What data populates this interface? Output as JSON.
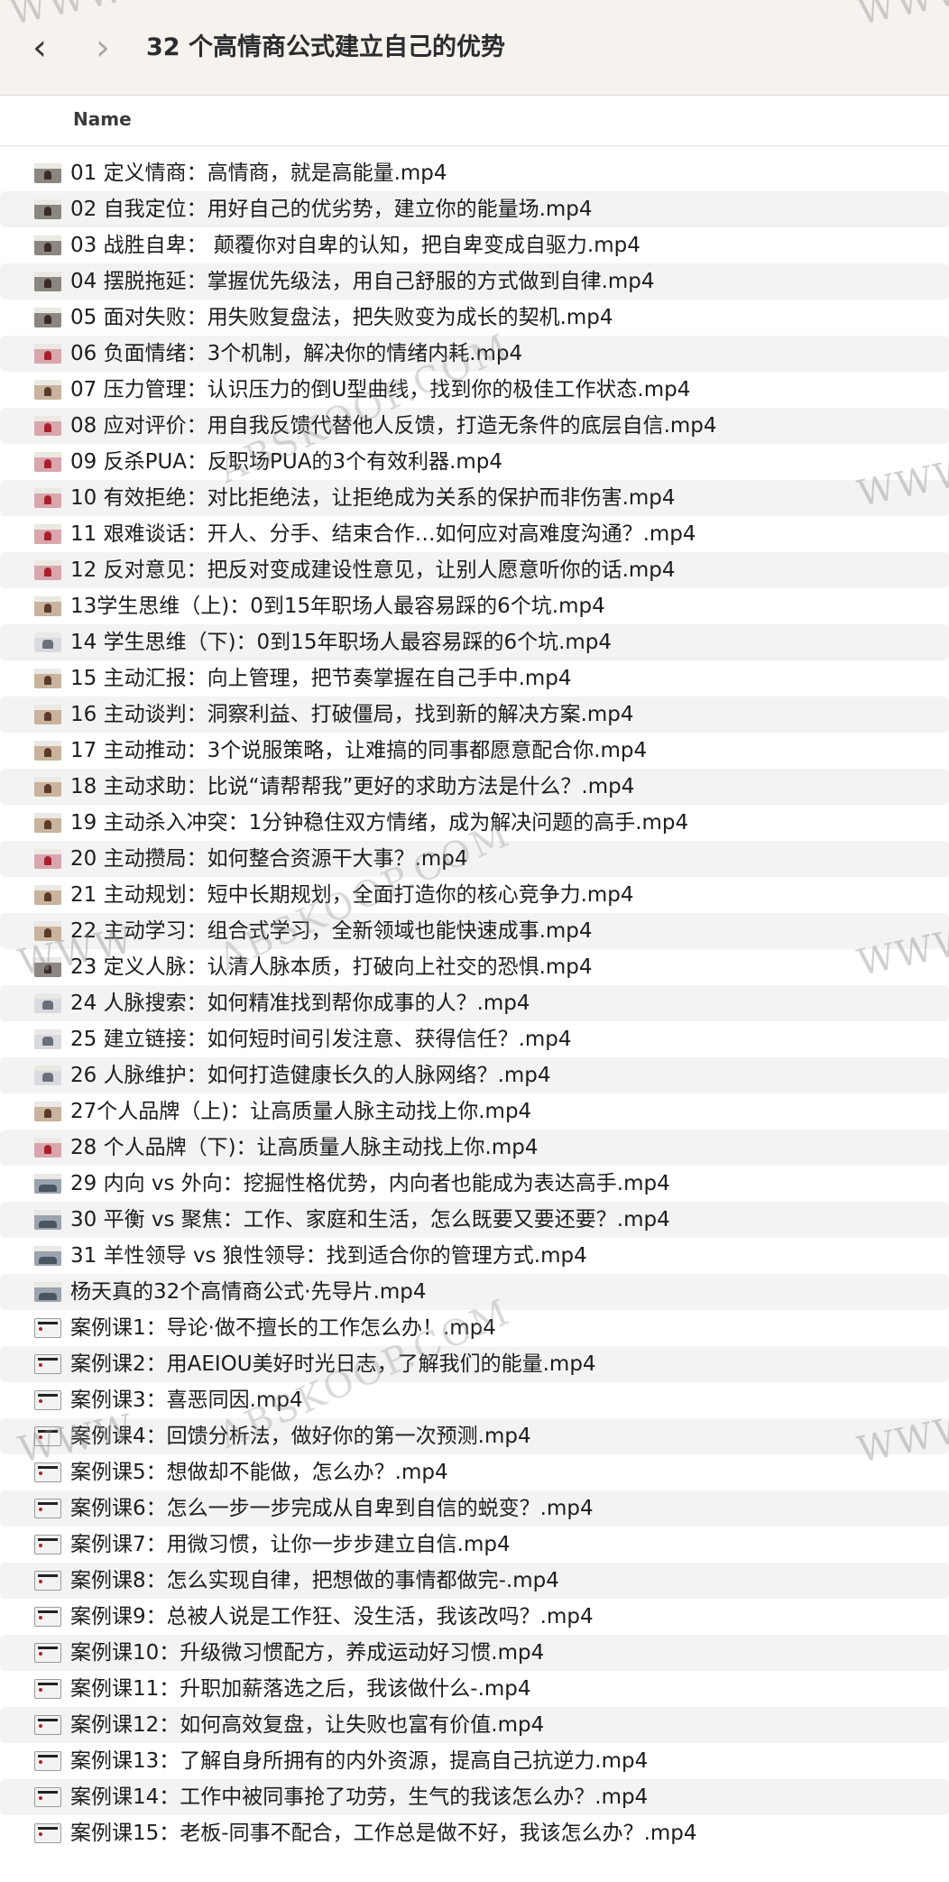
{
  "window": {
    "title": "32 个高情商公式建立自己的优势",
    "back_icon": "chevron-left-icon",
    "forward_icon": "chevron-right-icon"
  },
  "table": {
    "column_name": "Name"
  },
  "files": [
    {
      "name": "01 定义情商：高情商，就是高能量.mp4",
      "thumb": "t-dark"
    },
    {
      "name": "02 自我定位：用好自己的优劣势，建立你的能量场.mp4",
      "thumb": "t-dark"
    },
    {
      "name": "03 战胜自卑： 颠覆你对自卑的认知，把自卑变成自驱力.mp4",
      "thumb": "t-dark"
    },
    {
      "name": "04 摆脱拖延：掌握优先级法，用自己舒服的方式做到自律.mp4",
      "thumb": "t-dark"
    },
    {
      "name": "05 面对失败：用失败复盘法，把失败变为成长的契机.mp4",
      "thumb": "t-dark"
    },
    {
      "name": "06 负面情绪：3个机制，解决你的情绪内耗.mp4",
      "thumb": "t-pink"
    },
    {
      "name": "07 压力管理：认识压力的倒U型曲线，找到你的极佳工作状态.mp4",
      "thumb": "t-warm"
    },
    {
      "name": "08 应对评价：用自我反馈代替他人反馈，打造无条件的底层自信.mp4",
      "thumb": "t-pink"
    },
    {
      "name": "09 反杀PUA：反职场PUA的3个有效利器.mp4",
      "thumb": "t-pink"
    },
    {
      "name": "10 有效拒绝：对比拒绝法，让拒绝成为关系的保护而非伤害.mp4",
      "thumb": "t-pink"
    },
    {
      "name": "11 艰难谈话：开人、分手、结束合作…如何应对高难度沟通？.mp4",
      "thumb": "t-pink"
    },
    {
      "name": "12 反对意见：把反对变成建设性意见，让别人愿意听你的话.mp4",
      "thumb": "t-pink"
    },
    {
      "name": "13学生思维（上)：0到15年职场人最容易踩的6个坑.mp4",
      "thumb": "t-warm"
    },
    {
      "name": "14 学生思维（下)：0到15年职场人最容易踩的6个坑.mp4",
      "thumb": "t-light"
    },
    {
      "name": "15 主动汇报：向上管理，把节奏掌握在自己手中.mp4",
      "thumb": "t-warm"
    },
    {
      "name": "16 主动谈判：洞察利益、打破僵局，找到新的解决方案.mp4",
      "thumb": "t-warm"
    },
    {
      "name": "17 主动推动：3个说服策略，让难搞的同事都愿意配合你.mp4",
      "thumb": "t-warm"
    },
    {
      "name": "18 主动求助：比说“请帮帮我”更好的求助方法是什么？.mp4",
      "thumb": "t-warm"
    },
    {
      "name": "19 主动杀入冲突：1分钟稳住双方情绪，成为解决问题的高手.mp4",
      "thumb": "t-warm"
    },
    {
      "name": "20 主动攒局：如何整合资源干大事？.mp4",
      "thumb": "t-pink"
    },
    {
      "name": "21 主动规划：短中长期规划，全面打造你的核心竞争力.mp4",
      "thumb": "t-warm"
    },
    {
      "name": "22 主动学习：组合式学习，全新领域也能快速成事.mp4",
      "thumb": "t-warm"
    },
    {
      "name": "23 定义人脉：认清人脉本质，打破向上社交的恐惧.mp4",
      "thumb": "t-dark"
    },
    {
      "name": "24 人脉搜索：如何精准找到帮你成事的人？.mp4",
      "thumb": "t-light"
    },
    {
      "name": "25 建立链接：如何短时间引发注意、获得信任？.mp4",
      "thumb": "t-light"
    },
    {
      "name": "26 人脉维护：如何打造健康长久的人脉网络？.mp4",
      "thumb": "t-light"
    },
    {
      "name": "27个人品牌（上)：让高质量人脉主动找上你.mp4",
      "thumb": "t-warm"
    },
    {
      "name": "28 个人品牌（下)：让高质量人脉主动找上你.mp4",
      "thumb": "t-pink"
    },
    {
      "name": "29  内向 vs 外向：挖掘性格优势，内向者也能成为表达高手.mp4",
      "thumb": "t-group"
    },
    {
      "name": "30 平衡 vs 聚焦：工作、家庭和生活，怎么既要又要还要？.mp4",
      "thumb": "t-group"
    },
    {
      "name": "31 羊性领导 vs 狼性领导：找到适合你的管理方式.mp4",
      "thumb": "t-group"
    },
    {
      "name": "杨天真的32个高情商公式·先导片.mp4",
      "thumb": "t-group"
    },
    {
      "name": "案例课1：导论·做不擅长的工作怎么办！.mp4",
      "thumb": "t-doc"
    },
    {
      "name": "案例课2：用AEIOU美好时光日志，了解我们的能量.mp4",
      "thumb": "t-doc"
    },
    {
      "name": "案例课3：喜恶同因.mp4",
      "thumb": "t-doc"
    },
    {
      "name": "案例课4：回馈分析法，做好你的第一次预测.mp4",
      "thumb": "t-doc"
    },
    {
      "name": "案例课5：想做却不能做，怎么办？.mp4",
      "thumb": "t-doc"
    },
    {
      "name": "案例课6：怎么一步一步完成从自卑到自信的蜕变？.mp4",
      "thumb": "t-doc"
    },
    {
      "name": "案例课7：用微习惯，让你一步步建立自信.mp4",
      "thumb": "t-doc"
    },
    {
      "name": "案例课8：怎么实现自律，把想做的事情都做完-.mp4",
      "thumb": "t-doc"
    },
    {
      "name": "案例课9：总被人说是工作狂、没生活，我该改吗？.mp4",
      "thumb": "t-doc"
    },
    {
      "name": "案例课10：升级微习惯配方，养成运动好习惯.mp4",
      "thumb": "t-doc"
    },
    {
      "name": "案例课11：升职加薪落选之后，我该做什么-.mp4",
      "thumb": "t-doc"
    },
    {
      "name": "案例课12：如何高效复盘，让失败也富有价值.mp4",
      "thumb": "t-doc"
    },
    {
      "name": "案例课13：了解自身所拥有的内外资源，提高自己抗逆力.mp4",
      "thumb": "t-doc"
    },
    {
      "name": "案例课14：工作中被同事抢了功劳，生气的我该怎么办？.mp4",
      "thumb": "t-doc"
    },
    {
      "name": "案例课15：老板-同事不配合，工作总是做不好，我该怎么办？.mp4",
      "thumb": "t-doc"
    }
  ],
  "watermarks": {
    "corner": "WWW",
    "site": "ABSKOOP.COM"
  }
}
